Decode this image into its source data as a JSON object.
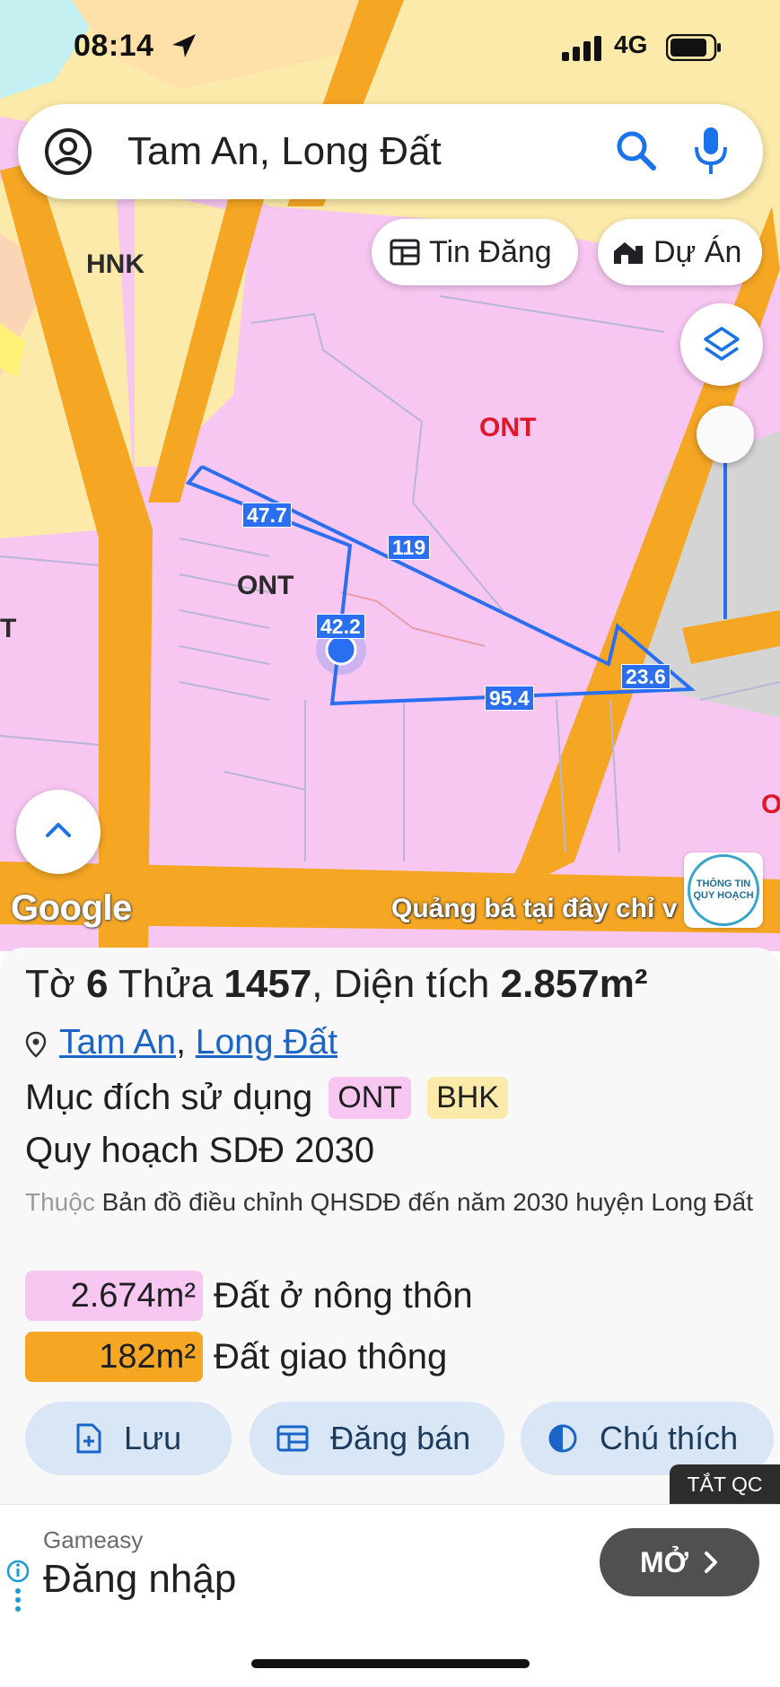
{
  "status": {
    "time": "08:14",
    "network": "4G"
  },
  "search": {
    "query": "Tam An, Long Đất"
  },
  "buttons": {
    "news": "Tin Đăng",
    "project": "Dự Án"
  },
  "map": {
    "zones": {
      "hnk": "HNK",
      "ont_right": "ONT",
      "ont_left": "ONT",
      "t_left": "T",
      "o_right": "O"
    },
    "dimensions": {
      "d1": "47.7",
      "d2": "119",
      "d3": "42.2",
      "d4": "23.6",
      "d5": "95.4"
    },
    "google": "Google",
    "promo": "Quảng bá tại đây chỉ v",
    "badge_line1": "THÔNG TIN",
    "badge_line2": "QUY HOẠCH",
    "colors": {
      "residential": "#f7c6f1",
      "road": "#f5a623",
      "agri": "#fbeaa9",
      "boundary": "#2a6ff1"
    }
  },
  "parcel": {
    "title_prefix": "Tờ",
    "sheet_no": "6",
    "plot_label": "Thửa",
    "plot_no": "1457",
    "area_label": ", Diện tích",
    "area": "2.857m²",
    "ward": "Tam An",
    "district": "Long Đất",
    "purpose_label": "Mục đích sử dụng",
    "purpose_codes": [
      "ONT",
      "BHK"
    ],
    "plan": "Quy hoạch SDĐ 2030",
    "belongs_label": "Thuộc",
    "belongs_text": "Bản đồ điều chỉnh QHSDĐ đến năm 2030 huyện Long Đất",
    "breakdown": [
      {
        "area": "2.674m²",
        "label": "Đất ở nông thôn"
      },
      {
        "area": "182m²",
        "label": "Đất giao thông"
      }
    ]
  },
  "actions": {
    "save": "Lưu",
    "sell": "Đăng bán",
    "legend": "Chú thích"
  },
  "ad": {
    "off_label": "TẮT QC",
    "brand": "Gameasy",
    "cta": "Đăng nhập",
    "open": "MỞ"
  }
}
